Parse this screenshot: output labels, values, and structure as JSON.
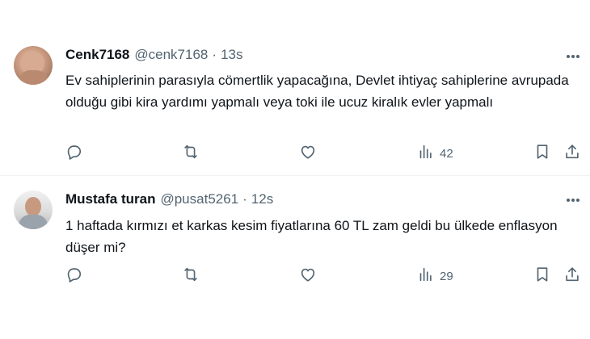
{
  "tweets": [
    {
      "name": "Cenk7168",
      "handle": "@cenk7168",
      "separator": "·",
      "time": "13s",
      "text": "Ev sahiplerinin parasıyla cömertlik yapacağına, Devlet ihtiyaç sahiplerine avrupada olduğu gibi kira yardımı yapmalı veya toki ile ucuz kiralık evler yapmalı",
      "views": "42"
    },
    {
      "name": "Mustafa turan",
      "handle": "@pusat5261",
      "separator": "·",
      "time": "12s",
      "text": "1 haftada kırmızı et karkas kesim fiyatlarına 60 TL zam geldi bu ülkede enflasyon düşer mi?",
      "views": "29"
    }
  ],
  "icons": {
    "more": "more-icon",
    "reply": "reply-icon",
    "retweet": "retweet-icon",
    "like": "like-icon",
    "views": "views-icon",
    "bookmark": "bookmark-icon",
    "share": "share-icon"
  },
  "colors": {
    "text": "#0f1419",
    "secondary": "#536471",
    "divider": "#eff3f4"
  }
}
